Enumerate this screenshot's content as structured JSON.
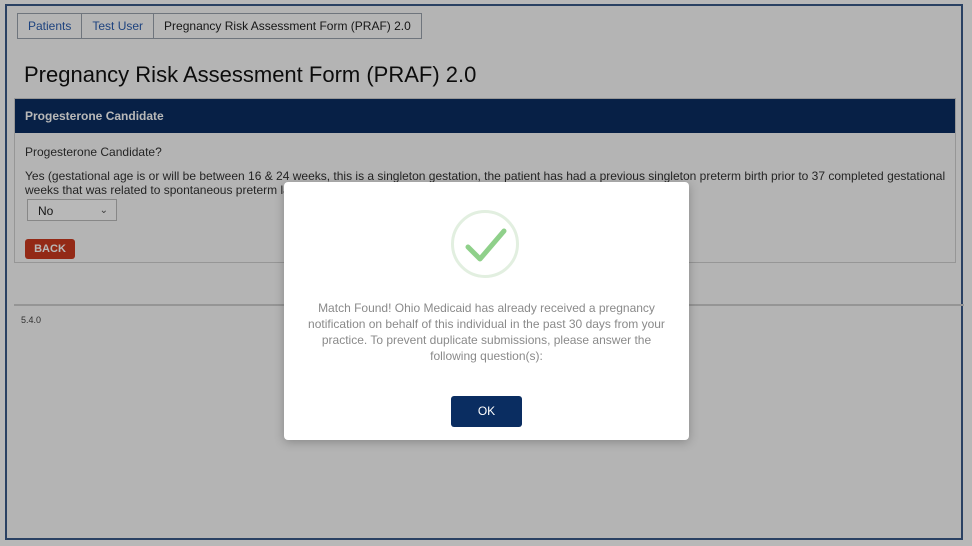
{
  "breadcrumb": {
    "items": [
      "Patients",
      "Test User",
      "Pregnancy Risk Assessment Form (PRAF) 2.0"
    ]
  },
  "page": {
    "title": "Pregnancy Risk Assessment Form (PRAF) 2.0"
  },
  "section": {
    "header": "Progesterone Candidate",
    "question_label": "Progesterone Candidate?",
    "question_text": "Yes (gestational age is or will be between 16 & 24 weeks, this is a singleton gestation, the patient has had a previous singleton preterm birth prior to 37 completed gestational weeks that was related to spontaneous preterm labor, preterm rupture",
    "select_value": "No",
    "back_label": "BACK"
  },
  "footer": {
    "version": "5.4.0"
  },
  "modal": {
    "message": "Match Found! Ohio Medicaid has already received a pregnancy notification on behalf of this individual in the past 30 days from your practice. To prevent duplicate submissions, please answer the following question(s):",
    "ok_label": "OK",
    "icon": "check-icon"
  },
  "colors": {
    "header": "#0a2d61",
    "back_button": "#cc3a1f",
    "ok_button": "#0a2d61",
    "check": "#8fd08a"
  }
}
